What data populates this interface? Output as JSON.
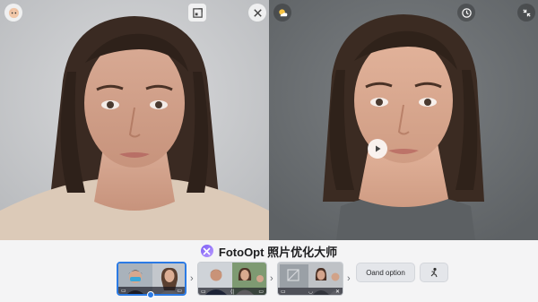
{
  "app": {
    "brand_name": "FotoOpt 照片优化大师",
    "accent_color": "#2b7ae4",
    "logo_color": "#7b5cf5"
  },
  "left_panel": {
    "top_left_icon": "profile-icon",
    "top_right_icons": [
      "crop-icon",
      "close-icon"
    ]
  },
  "right_panel": {
    "top_left_icon": "weather-icon",
    "top_right_icons": [
      "timer-icon",
      "collapse-icon"
    ],
    "center_icon": "play-icon"
  },
  "filmstrip": {
    "thumbs": [
      {
        "name": "thumb-1",
        "bar_left": "▭",
        "bar_right": "▭"
      },
      {
        "name": "thumb-2",
        "bar_left": "▭",
        "bar_mid": "⟨|",
        "bar_right": "▭"
      },
      {
        "name": "thumb-3",
        "bar_left": "▭",
        "bar_mid": "◡",
        "bar_right": "✕"
      }
    ],
    "option_label": "Oand option",
    "extra_icon": "person-pose-icon"
  }
}
